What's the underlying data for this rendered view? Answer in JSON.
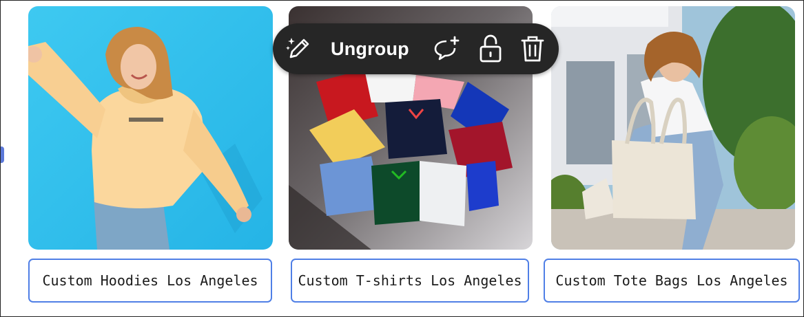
{
  "toolbar": {
    "magic_edit_icon": "magic-pencil-icon",
    "ungroup_label": "Ungroup",
    "comment_icon": "comment-add-icon",
    "lock_icon": "lock-icon",
    "delete_icon": "trash-icon"
  },
  "cards": [
    {
      "caption": "Custom Hoodies Los Angeles"
    },
    {
      "caption": "Custom T-shirts Los Angeles"
    },
    {
      "caption": "Custom Tote Bags Los Angeles"
    }
  ],
  "colors": {
    "caption_border": "#4f7fe6",
    "toolbar_bg": "#262626",
    "hoodie_bg": "#36c4ee"
  }
}
